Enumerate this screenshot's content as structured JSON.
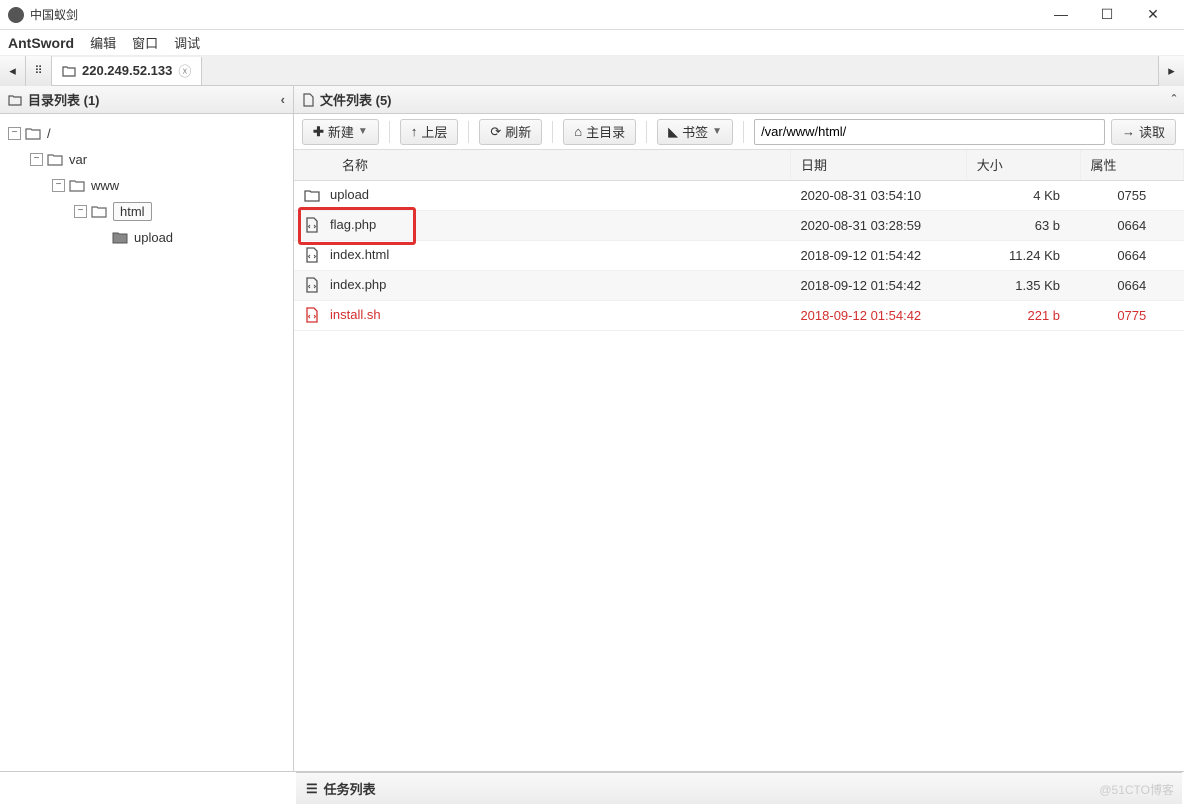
{
  "window": {
    "title": "中国蚁剑"
  },
  "menu": {
    "brand": "AntSword",
    "items": [
      "编辑",
      "窗口",
      "调试"
    ]
  },
  "tabs": {
    "active": "220.249.52.133"
  },
  "left": {
    "header": "目录列表 (1)",
    "tree": {
      "root": "/",
      "n1": "var",
      "n2": "www",
      "n3": "html",
      "n4": "upload"
    }
  },
  "right": {
    "header": "文件列表 (5)",
    "toolbar": {
      "new": "新建",
      "up": "上层",
      "refresh": "刷新",
      "home": "主目录",
      "bookmark": "书签",
      "read": "读取",
      "path": "/var/www/html/"
    },
    "columns": {
      "name": "名称",
      "date": "日期",
      "size": "大小",
      "attr": "属性"
    },
    "rows": [
      {
        "name": "upload",
        "date": "2020-08-31 03:54:10",
        "size": "4 Kb",
        "attr": "0755",
        "type": "folder"
      },
      {
        "name": "flag.php",
        "date": "2020-08-31 03:28:59",
        "size": "63 b",
        "attr": "0664",
        "type": "code"
      },
      {
        "name": "index.html",
        "date": "2018-09-12 01:54:42",
        "size": "11.24 Kb",
        "attr": "0664",
        "type": "code"
      },
      {
        "name": "index.php",
        "date": "2018-09-12 01:54:42",
        "size": "1.35 Kb",
        "attr": "0664",
        "type": "code"
      },
      {
        "name": "install.sh",
        "date": "2018-09-12 01:54:42",
        "size": "221 b",
        "attr": "0775",
        "type": "script",
        "red": true
      }
    ]
  },
  "task": {
    "label": "任务列表"
  },
  "watermark": "@51CTO博客"
}
